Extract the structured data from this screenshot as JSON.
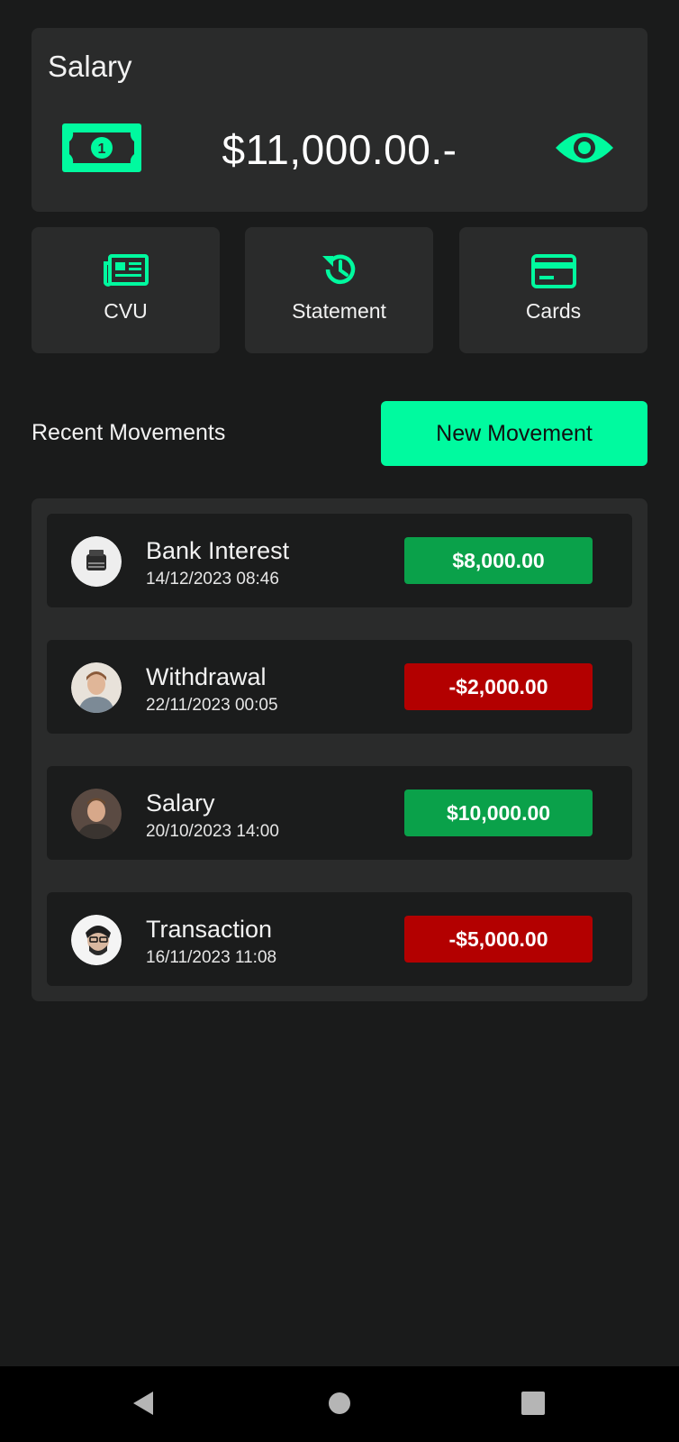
{
  "balance": {
    "title": "Salary",
    "amount": "$11,000.00.-",
    "currency_icon": "money-bill-icon",
    "visibility_icon": "eye-icon"
  },
  "actions": [
    {
      "label": "CVU",
      "icon": "newspaper-icon"
    },
    {
      "label": "Statement",
      "icon": "history-icon"
    },
    {
      "label": "Cards",
      "icon": "credit-card-icon"
    }
  ],
  "recent": {
    "title": "Recent Movements",
    "new_button": "New Movement"
  },
  "movements": [
    {
      "title": "Bank Interest",
      "date": "14/12/2023 08:46",
      "amount": "$8,000.00",
      "type": "positive"
    },
    {
      "title": "Withdrawal",
      "date": "22/11/2023 00:05",
      "amount": "-$2,000.00",
      "type": "negative"
    },
    {
      "title": "Salary",
      "date": "20/10/2023 14:00",
      "amount": "$10,000.00",
      "type": "positive"
    },
    {
      "title": "Transaction",
      "date": "16/11/2023 11:08",
      "amount": "-$5,000.00",
      "type": "negative"
    }
  ],
  "colors": {
    "accent": "#00fa9f",
    "background": "#1a1b1b",
    "card": "#2a2b2b",
    "positive": "#0aa14a",
    "negative": "#b30000"
  },
  "nav": {
    "back_icon": "back-triangle-icon",
    "home_icon": "home-circle-icon",
    "recents_icon": "recents-square-icon"
  }
}
